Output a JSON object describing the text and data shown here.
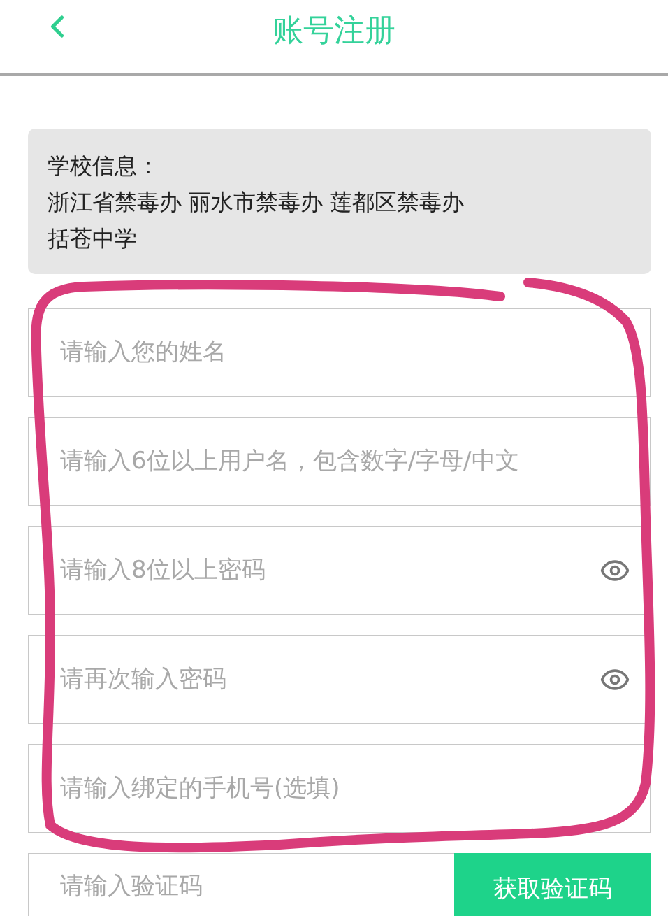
{
  "header": {
    "title": "账号注册"
  },
  "school_info": {
    "label": "学校信息：",
    "lines": [
      "浙江省禁毒办 丽水市禁毒办 莲都区禁毒办",
      "括苍中学"
    ]
  },
  "fields": [
    {
      "kind": "text",
      "placeholder": "请输入您的姓名"
    },
    {
      "kind": "text",
      "placeholder": "请输入6位以上用户名，包含数字/字母/中文"
    },
    {
      "kind": "password",
      "placeholder": "请输入8位以上密码"
    },
    {
      "kind": "password",
      "placeholder": "请再次输入密码"
    },
    {
      "kind": "text",
      "placeholder": "请输入绑定的手机号(选填)"
    }
  ],
  "verification": {
    "placeholder": "请输入验证码",
    "button": "获取验证码"
  }
}
